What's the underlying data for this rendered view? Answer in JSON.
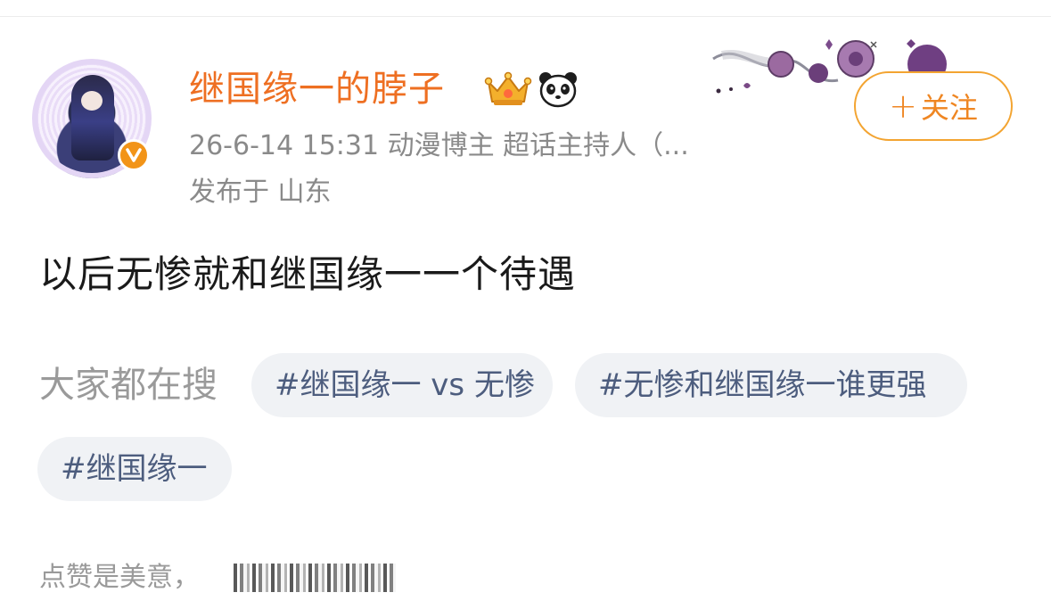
{
  "header": {
    "username": "继国缘一的脖子",
    "meta": "26-6-14 15:31  动漫博主 超话主持人（...",
    "location": "发布于 山东",
    "follow_label": "关注",
    "follow_plus": "+"
  },
  "badges": [
    "crown-icon",
    "panda-icon"
  ],
  "post": {
    "text": "以后无惨就和继国缘一一个待遇"
  },
  "search": {
    "label": "大家都在搜",
    "tags": [
      "#继国缘一 vs 无惨",
      "#无惨和继国缘一谁更强",
      "#继国缘一"
    ]
  },
  "footer": {
    "like_text": "点赞是美意，"
  },
  "colors": {
    "username": "#ee6f22",
    "follow_border": "#f3a431",
    "tag_bg": "#f0f2f5",
    "tag_text": "#4d5d7e",
    "muted": "#8a8a8a"
  }
}
